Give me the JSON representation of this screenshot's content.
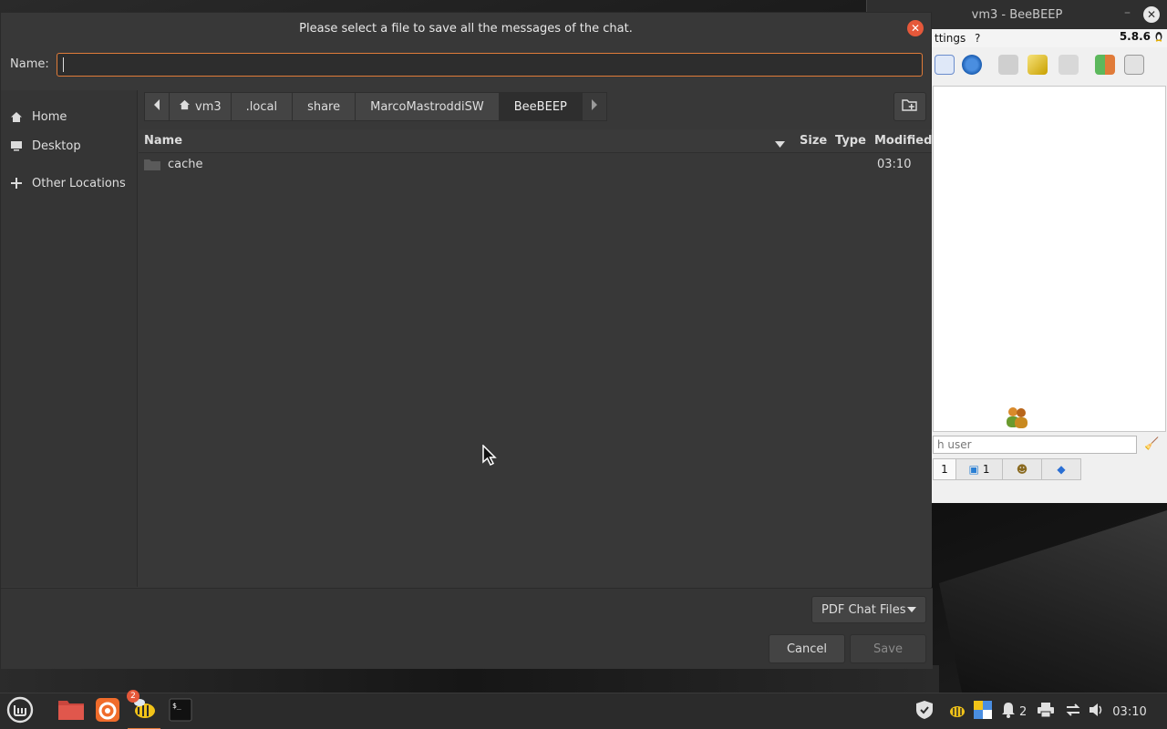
{
  "background_window": {
    "title": "vm3 - BeeBEEP",
    "menu_settings": "ttings",
    "menu_help": "?",
    "version": "5.8.6",
    "search_placeholder": "h user",
    "tabs": [
      {
        "label": "1",
        "icon": "users-icon"
      },
      {
        "label": "1",
        "icon": "chat-icon"
      },
      {
        "label": "",
        "icon": "groups-icon"
      },
      {
        "label": "",
        "icon": "share-icon"
      }
    ]
  },
  "dialog": {
    "title": "Please select a file to save all the messages of the chat.",
    "name_label": "Name:",
    "name_value": "",
    "sidebar": [
      {
        "label": "Home",
        "icon": "home-icon"
      },
      {
        "label": "Desktop",
        "icon": "desktop-icon"
      },
      {
        "label": "Other Locations",
        "icon": "plus-icon"
      }
    ],
    "path": [
      "vm3",
      ".local",
      "share",
      "MarcoMastroddiSW",
      "BeeBEEP"
    ],
    "columns": {
      "name": "Name",
      "size": "Size",
      "type": "Type",
      "modified": "Modified"
    },
    "files": [
      {
        "name": "cache",
        "size": "",
        "type": "",
        "modified": "03:10",
        "icon": "folder-icon"
      }
    ],
    "filter": "PDF Chat Files",
    "cancel": "Cancel",
    "save": "Save"
  },
  "taskbar": {
    "apps": [
      {
        "name": "menu-icon"
      },
      {
        "name": "files-icon"
      },
      {
        "name": "firefox-icon"
      },
      {
        "name": "beebeep-icon",
        "badge": "2"
      },
      {
        "name": "terminal-icon"
      }
    ],
    "notifications_count": "2",
    "clock": "03:10"
  },
  "colors": {
    "accent": "#e07b39",
    "close": "#e5583a",
    "dialog_bg": "#383838"
  }
}
